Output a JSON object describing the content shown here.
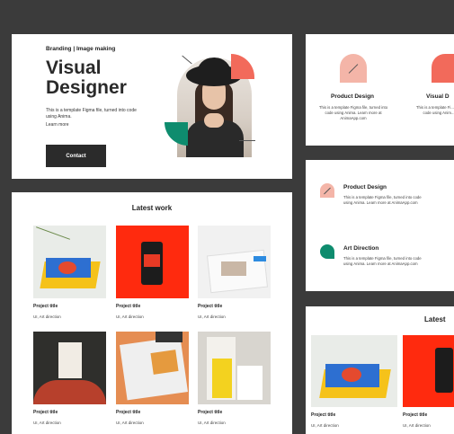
{
  "hero": {
    "eyebrow": "Branding | Image making",
    "title_line1": "Visual",
    "title_line2": "Designer",
    "description": "This is a template Figma file, turned into code using Anima.",
    "learn_more": "Learn more",
    "cta": "Contact"
  },
  "work": {
    "title": "Latest work",
    "projects": [
      {
        "title": "Project title",
        "subtitle": "UI, Art direction"
      },
      {
        "title": "Project title",
        "subtitle": "UI, Art direction"
      },
      {
        "title": "Project title",
        "subtitle": "UI, Art direction"
      },
      {
        "title": "Project title",
        "subtitle": "UI, Art direction"
      },
      {
        "title": "Project title",
        "subtitle": "UI, Art direction"
      },
      {
        "title": "Project title",
        "subtitle": "UI, Art direction"
      }
    ]
  },
  "services_top": [
    {
      "title": "Product Design",
      "desc": "This is a template Figma file, turned into code using Anima. Learn more at AnimaApp.com"
    },
    {
      "title": "Visual D",
      "desc": "This is a template Fi... into code using Anim..."
    }
  ],
  "services_list": [
    {
      "title": "Product Design",
      "desc": "This is a template Figma file, turned into code using Anima. Learn more at AnimaApp.com"
    },
    {
      "title": "Art Direction",
      "desc": "This is a template Figma file, turned into code using Anima. Learn more at AnimaApp.com"
    }
  ],
  "latest_partial": {
    "title": "Latest",
    "projects": [
      {
        "title": "Project title",
        "subtitle": "UI, Art direction"
      },
      {
        "title": "Project title",
        "subtitle": "UI, Art direction"
      }
    ]
  },
  "colors": {
    "coral": "#f26a5b",
    "green": "#0e8c6e",
    "pink": "#f4b5a8",
    "dark": "#2b2b2b"
  }
}
